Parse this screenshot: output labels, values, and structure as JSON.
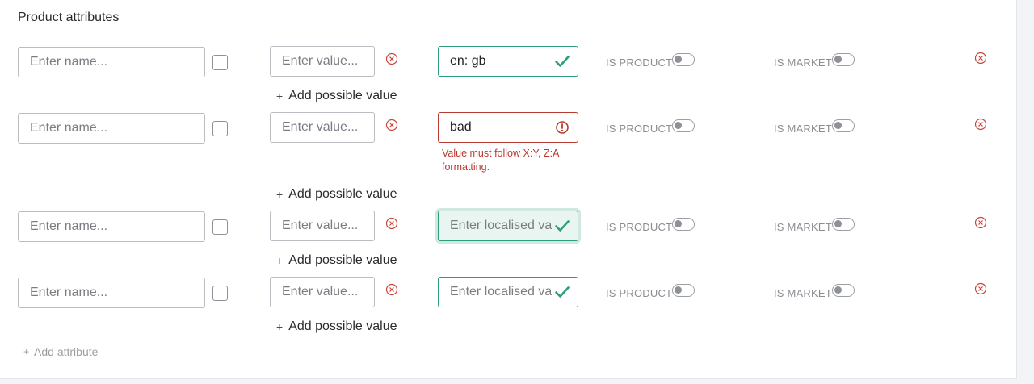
{
  "section": {
    "title": "Product attributes"
  },
  "placeholders": {
    "name": "Enter name...",
    "value": "Enter value...",
    "localised": "Enter localised value"
  },
  "labels": {
    "is_product": "IS PRODUCT",
    "is_market": "IS MARKET",
    "add_possible_value": "Add possible value",
    "add_attribute": "Add attribute"
  },
  "rows": [
    {
      "localised_value": "en: gb",
      "status": "valid",
      "is_product": false,
      "is_market": false
    },
    {
      "localised_value": "bad",
      "status": "error",
      "error_message": "Value must follow X:Y, Z:A formatting.",
      "is_product": false,
      "is_market": false
    },
    {
      "localised_value": "",
      "status": "valid",
      "focused": true,
      "is_product": false,
      "is_market": false
    },
    {
      "localised_value": "",
      "status": "valid",
      "is_product": false,
      "is_market": false
    }
  ],
  "colors": {
    "valid": "#2f9b7f",
    "error": "#b93a31",
    "muted": "#8a8d92"
  },
  "icons": {
    "remove": "circle-x-icon",
    "valid": "checkmark-icon",
    "error": "alert-circle-icon",
    "add": "plus-icon"
  }
}
